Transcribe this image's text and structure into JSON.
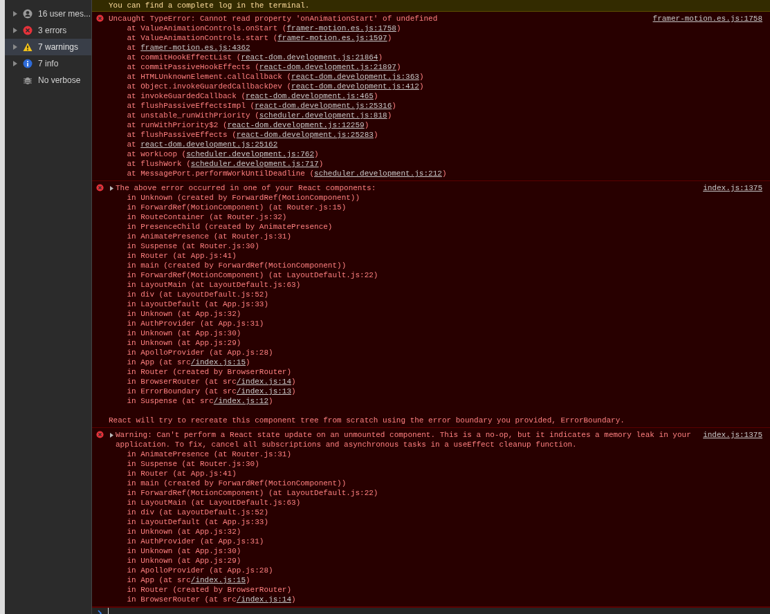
{
  "sidebar": {
    "items": [
      {
        "kind": "user",
        "label": "16 user mes...",
        "selected": false,
        "expandable": true
      },
      {
        "kind": "error",
        "label": "3 errors",
        "selected": false,
        "expandable": true
      },
      {
        "kind": "warning",
        "label": "7 warnings",
        "selected": true,
        "expandable": true
      },
      {
        "kind": "info",
        "label": "7 info",
        "selected": false,
        "expandable": true
      },
      {
        "kind": "verbose",
        "label": "No verbose",
        "selected": false,
        "expandable": false
      }
    ]
  },
  "console": {
    "banner": "You can find a complete log in the terminal.",
    "messages": [
      {
        "kind": "error",
        "collapsible": false,
        "text": "Uncaught TypeError: Cannot read property 'onAnimationStart' of undefined",
        "source": "framer-motion.es.js:1758",
        "stack": [
          {
            "prefix": "at ValueAnimationControls.onStart (",
            "link": "framer-motion.es.js:1758",
            "suffix": ")"
          },
          {
            "prefix": "at ValueAnimationControls.start (",
            "link": "framer-motion.es.js:1597",
            "suffix": ")"
          },
          {
            "prefix": "at ",
            "link": "framer-motion.es.js:4362"
          },
          {
            "prefix": "at commitHookEffectList (",
            "link": "react-dom.development.js:21864",
            "suffix": ")"
          },
          {
            "prefix": "at commitPassiveHookEffects (",
            "link": "react-dom.development.js:21897",
            "suffix": ")"
          },
          {
            "prefix": "at HTMLUnknownElement.callCallback (",
            "link": "react-dom.development.js:363",
            "suffix": ")"
          },
          {
            "prefix": "at Object.invokeGuardedCallbackDev (",
            "link": "react-dom.development.js:412",
            "suffix": ")"
          },
          {
            "prefix": "at invokeGuardedCallback (",
            "link": "react-dom.development.js:465",
            "suffix": ")"
          },
          {
            "prefix": "at flushPassiveEffectsImpl (",
            "link": "react-dom.development.js:25316",
            "suffix": ")"
          },
          {
            "prefix": "at unstable_runWithPriority (",
            "link": "scheduler.development.js:818",
            "suffix": ")"
          },
          {
            "prefix": "at runWithPriority$2 (",
            "link": "react-dom.development.js:12259",
            "suffix": ")"
          },
          {
            "prefix": "at flushPassiveEffects (",
            "link": "react-dom.development.js:25283",
            "suffix": ")"
          },
          {
            "prefix": "at ",
            "link": "react-dom.development.js:25162"
          },
          {
            "prefix": "at workLoop (",
            "link": "scheduler.development.js:762",
            "suffix": ")"
          },
          {
            "prefix": "at flushWork (",
            "link": "scheduler.development.js:717",
            "suffix": ")"
          },
          {
            "prefix": "at MessagePort.performWorkUntilDeadline (",
            "link": "scheduler.development.js:212",
            "suffix": ")"
          }
        ]
      },
      {
        "kind": "error",
        "collapsible": true,
        "text": "The above error occurred in one of your React components:",
        "source": "index.js:1375",
        "stack": [
          {
            "prefix": "in Unknown (created by ForwardRef(MotionComponent))"
          },
          {
            "prefix": "in ForwardRef(MotionComponent) (at Router.js:15)"
          },
          {
            "prefix": "in RouteContainer (at Router.js:32)"
          },
          {
            "prefix": "in PresenceChild (created by AnimatePresence)"
          },
          {
            "prefix": "in AnimatePresence (at Router.js:31)"
          },
          {
            "prefix": "in Suspense (at Router.js:30)"
          },
          {
            "prefix": "in Router (at App.js:41)"
          },
          {
            "prefix": "in main (created by ForwardRef(MotionComponent))"
          },
          {
            "prefix": "in ForwardRef(MotionComponent) (at LayoutDefault.js:22)"
          },
          {
            "prefix": "in LayoutMain (at LayoutDefault.js:63)"
          },
          {
            "prefix": "in div (at LayoutDefault.js:52)"
          },
          {
            "prefix": "in LayoutDefault (at App.js:33)"
          },
          {
            "prefix": "in Unknown (at App.js:32)"
          },
          {
            "prefix": "in AuthProvider (at App.js:31)"
          },
          {
            "prefix": "in Unknown (at App.js:30)"
          },
          {
            "prefix": "in Unknown (at App.js:29)"
          },
          {
            "prefix": "in ApolloProvider (at App.js:28)"
          },
          {
            "prefix": "in App (at src",
            "link": "/index.js:15",
            "suffix": ")"
          },
          {
            "prefix": "in Router (created by BrowserRouter)"
          },
          {
            "prefix": "in BrowserRouter (at src",
            "link": "/index.js:14",
            "suffix": ")"
          },
          {
            "prefix": "in ErrorBoundary (at src",
            "link": "/index.js:13",
            "suffix": ")"
          },
          {
            "prefix": "in Suspense (at src",
            "link": "/index.js:12",
            "suffix": ")"
          }
        ],
        "footer": "React will try to recreate this component tree from scratch using the error boundary you provided, ErrorBoundary."
      },
      {
        "kind": "error",
        "collapsible": true,
        "text": "Warning: Can't perform a React state update on an unmounted component. This is a no-op, but it indicates a memory leak in your application. To fix, cancel all subscriptions and asynchronous tasks in a useEffect cleanup function.",
        "source": "index.js:1375",
        "stack": [
          {
            "prefix": "in AnimatePresence (at Router.js:31)"
          },
          {
            "prefix": "in Suspense (at Router.js:30)"
          },
          {
            "prefix": "in Router (at App.js:41)"
          },
          {
            "prefix": "in main (created by ForwardRef(MotionComponent))"
          },
          {
            "prefix": "in ForwardRef(MotionComponent) (at LayoutDefault.js:22)"
          },
          {
            "prefix": "in LayoutMain (at LayoutDefault.js:63)"
          },
          {
            "prefix": "in div (at LayoutDefault.js:52)"
          },
          {
            "prefix": "in LayoutDefault (at App.js:33)"
          },
          {
            "prefix": "in Unknown (at App.js:32)"
          },
          {
            "prefix": "in AuthProvider (at App.js:31)"
          },
          {
            "prefix": "in Unknown (at App.js:30)"
          },
          {
            "prefix": "in Unknown (at App.js:29)"
          },
          {
            "prefix": "in ApolloProvider (at App.js:28)"
          },
          {
            "prefix": "in App (at src",
            "link": "/index.js:15",
            "suffix": ")"
          },
          {
            "prefix": "in Router (created by BrowserRouter)"
          },
          {
            "prefix": "in BrowserRouter (at src",
            "link": "/index.js:14",
            "suffix": ")"
          }
        ]
      }
    ]
  }
}
